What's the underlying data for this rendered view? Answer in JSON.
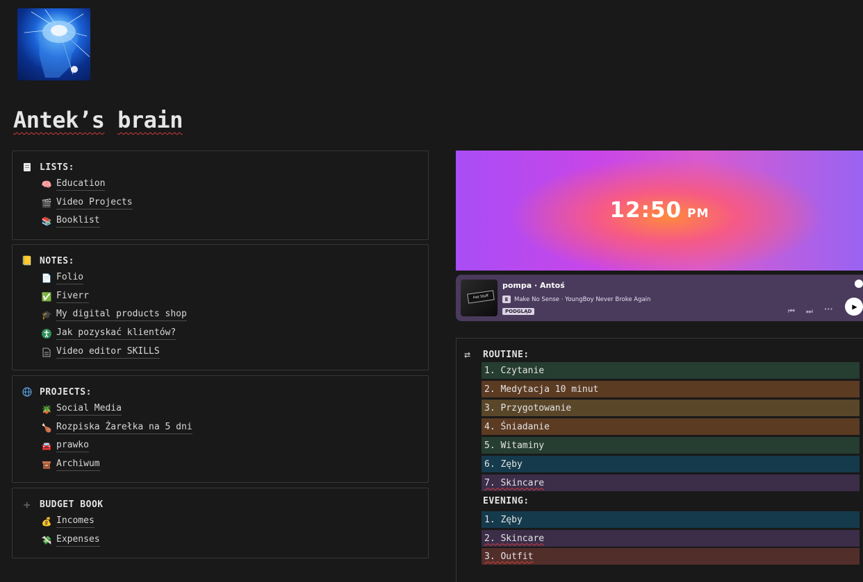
{
  "page": {
    "title": "Antek’s brain",
    "title_part1": "Antek’s",
    "title_part2": "brain"
  },
  "sections": {
    "lists": {
      "header": "LISTS:",
      "icon": "scroll-icon",
      "items": [
        {
          "label": "Education",
          "icon": "brain-icon"
        },
        {
          "label": "Video Projects",
          "icon": "clapperboard-icon"
        },
        {
          "label": "Booklist",
          "icon": "books-icon"
        }
      ]
    },
    "notes": {
      "header": "NOTES:",
      "icon": "notebook-icon",
      "items": [
        {
          "label": "Folio",
          "icon": "page-icon"
        },
        {
          "label": "Fiverr",
          "icon": "check-mark-icon"
        },
        {
          "label": "My digital products shop",
          "icon": "graduation-cap-icon"
        },
        {
          "label": "Jak pozyskać klientów?",
          "icon": "accessibility-icon"
        },
        {
          "label": "Video editor SKILLS",
          "icon": "document-icon"
        }
      ]
    },
    "projects": {
      "header": "PROJECTS:",
      "icon": "globe-icon",
      "items": [
        {
          "label": "Social Media",
          "icon": "potted-plant-icon"
        },
        {
          "label": "Rozpiska Żarełka na 5 dni",
          "icon": "drumstick-icon"
        },
        {
          "label": "prawko",
          "icon": "car-icon"
        },
        {
          "label": "Archiwum",
          "icon": "archive-box-icon"
        }
      ]
    },
    "budget": {
      "header": "BUDGET BOOK",
      "icon": "plus-icon",
      "items": [
        {
          "label": "Incomes",
          "icon": "money-bag-icon"
        },
        {
          "label": "Expenses",
          "icon": "flying-money-icon"
        }
      ]
    }
  },
  "clock": {
    "time": "12:50",
    "ampm": "PM"
  },
  "spotify": {
    "title": "pompa · Antoś",
    "explicit": "E",
    "subtitle": "Make No Sense · YoungBoy Never Broke Again",
    "badge": "PODGLĄD",
    "art_text": "Hot Stuff"
  },
  "routine": {
    "header": "ROUTINE:",
    "items": [
      {
        "label": "1. Czytanie",
        "color": "#263d31"
      },
      {
        "label": "2. Medytacja 10 minut",
        "color": "#5c3b23"
      },
      {
        "label": "3. Przygotowanie",
        "color": "#5a4629"
      },
      {
        "label": "4. Śniadanie",
        "color": "#5c3b23"
      },
      {
        "label": "5. Witaminy",
        "color": "#263d31"
      },
      {
        "label": "6. Zęby",
        "color": "#153a4c"
      },
      {
        "label": "7. Skincare",
        "color": "#3c2d49"
      }
    ],
    "evening_header": "EVENING:",
    "evening_items": [
      {
        "label": "1. Zęby",
        "color": "#153a4c"
      },
      {
        "label": "2. Skincare",
        "color": "#3c2d49"
      },
      {
        "label": "3. Outfit",
        "color": "#522e2a"
      }
    ]
  }
}
